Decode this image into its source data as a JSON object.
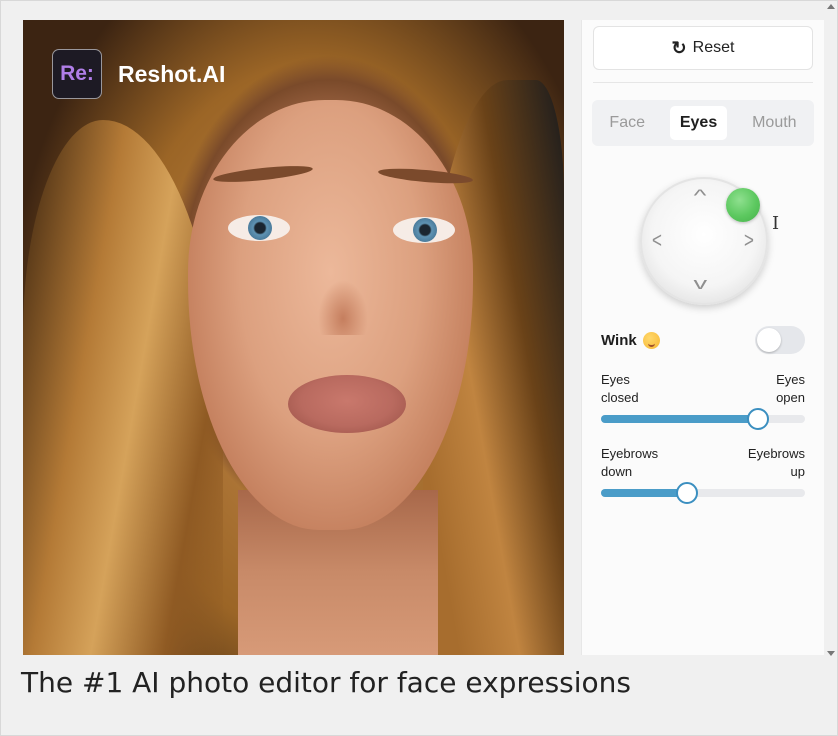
{
  "brand": {
    "logo_text": "Re:",
    "name": "Reshot.AI"
  },
  "panel": {
    "reset_label": "Reset",
    "reset_icon": "refresh-icon",
    "tabs": [
      {
        "label": "Face",
        "active": false
      },
      {
        "label": "Eyes",
        "active": true
      },
      {
        "label": "Mouth",
        "active": false
      }
    ],
    "joystick": {
      "arrows": [
        "up",
        "down",
        "left",
        "right"
      ],
      "knob_color": "#5cc85f"
    },
    "wink": {
      "label": "Wink",
      "emoji": "winking-face",
      "enabled": false
    },
    "sliders": [
      {
        "left_label_1": "Eyes",
        "left_label_2": "closed",
        "right_label_1": "Eyes",
        "right_label_2": "open",
        "value": 0.77
      },
      {
        "left_label_1": "Eyebrows",
        "left_label_2": "down",
        "right_label_1": "Eyebrows",
        "right_label_2": "up",
        "value": 0.42
      }
    ],
    "accent_color": "#4a9cc8"
  },
  "caption": "The #1 AI photo editor for face expressions"
}
